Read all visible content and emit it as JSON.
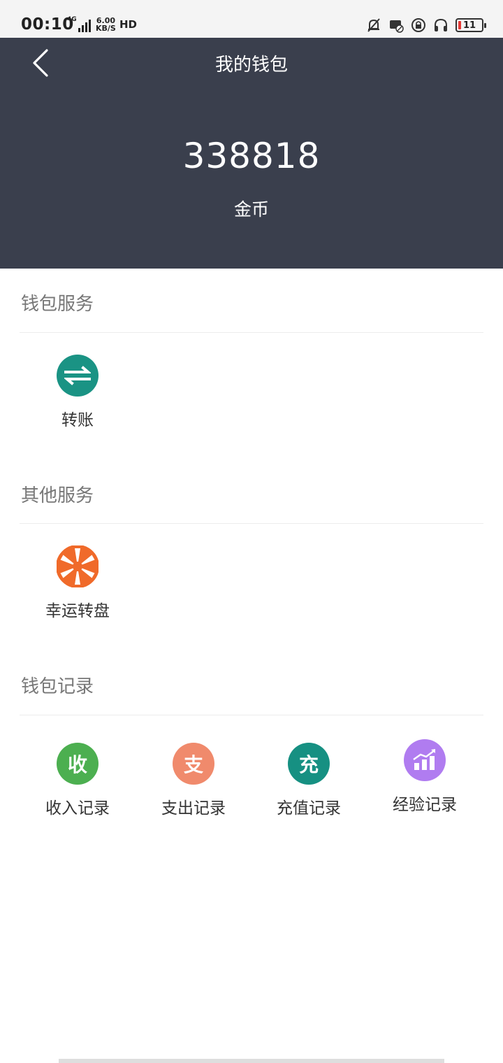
{
  "status_bar": {
    "time": "00:10",
    "network": "4G",
    "speed_value": "6.00",
    "speed_unit": "KB/S",
    "hd": "HD",
    "battery": "11"
  },
  "header": {
    "title": "我的钱包",
    "balance": "338818",
    "unit": "金币"
  },
  "sections": {
    "wallet_services": {
      "title": "钱包服务",
      "items": [
        {
          "label": "转账",
          "icon": "transfer-arrows-icon",
          "color": "#1a9384"
        }
      ]
    },
    "other_services": {
      "title": "其他服务",
      "items": [
        {
          "label": "幸运转盘",
          "icon": "lucky-wheel-icon",
          "color": "#f06a2a"
        }
      ]
    },
    "wallet_records": {
      "title": "钱包记录",
      "items": [
        {
          "label": "收入记录",
          "glyph": "收",
          "icon": "income-icon",
          "color": "#4caf50"
        },
        {
          "label": "支出记录",
          "glyph": "支",
          "icon": "expense-icon",
          "color": "#f08a6c"
        },
        {
          "label": "充值记录",
          "glyph": "充",
          "icon": "recharge-icon",
          "color": "#169082"
        },
        {
          "label": "经验记录",
          "icon": "experience-chart-icon",
          "color": "#b07cf0"
        }
      ]
    }
  }
}
